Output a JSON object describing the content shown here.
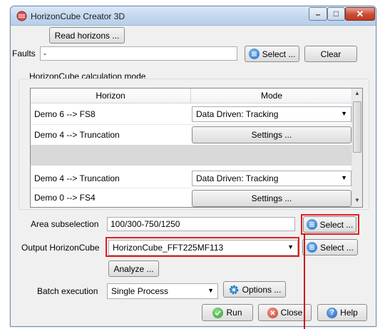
{
  "window": {
    "title": "HorizonCube Creator 3D",
    "close_glyph": "✕",
    "min_glyph": "–",
    "max_glyph": "□"
  },
  "read_horizons_label": "Read horizons ...",
  "faults": {
    "label": "Faults",
    "value": "-",
    "select_label": "Select ...",
    "clear_label": "Clear"
  },
  "calc_mode_title": "HorizonCube calculation mode",
  "table": {
    "columns": [
      "Horizon",
      "Mode"
    ],
    "rows": [
      {
        "horizon": "Demo 6 --> FS8",
        "mode": "Data Driven: Tracking",
        "mode_type": "combo"
      },
      {
        "horizon": "Demo 4 --> Truncation",
        "mode": "Settings ...",
        "mode_type": "button"
      },
      {
        "horizon": "",
        "mode": "",
        "mode_type": "empty"
      },
      {
        "horizon": "Demo 4 --> Truncation",
        "mode": "Data Driven: Tracking",
        "mode_type": "combo"
      },
      {
        "horizon": "Demo 0 --> FS4",
        "mode": "Settings ...",
        "mode_type": "button"
      }
    ]
  },
  "area": {
    "label": "Area subselection",
    "value": "100/300-750/1250",
    "select_label": "Select ..."
  },
  "output": {
    "label": "Output HorizonCube",
    "value": "HorizonCube_FFT225MF113",
    "select_label": "Select ..."
  },
  "analyze_label": "Analyze ...",
  "batch": {
    "label": "Batch execution",
    "value": "Single Process",
    "options_label": "Options ..."
  },
  "footer": {
    "run_label": "Run",
    "close_label": "Close",
    "help_label": "Help",
    "help_glyph": "?"
  },
  "colors": {
    "highlight": "#e02020",
    "accent_blue": "#1f6fc4"
  }
}
